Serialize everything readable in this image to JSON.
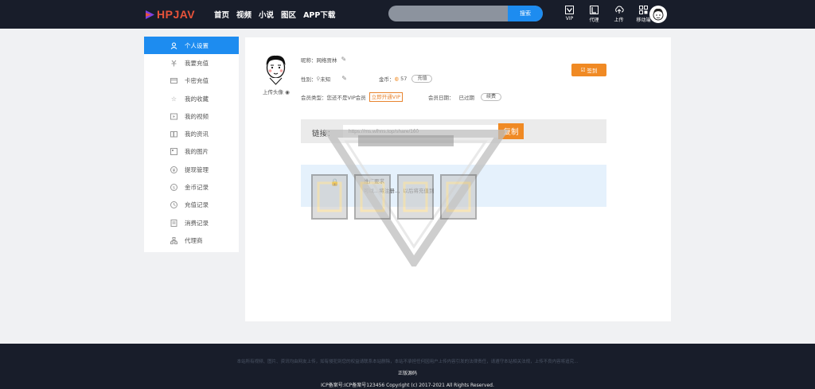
{
  "header": {
    "logo_text": "HPJAV",
    "nav": [
      "首页",
      "视频",
      "小说",
      "图区",
      "APP下载"
    ],
    "search": {
      "placeholder": "",
      "button_label": "搜索"
    },
    "icons": [
      {
        "label": "VIP",
        "icon": "vip-icon"
      },
      {
        "label": "代理",
        "icon": "agent-icon"
      },
      {
        "label": "上传",
        "icon": "upload-icon"
      },
      {
        "label": "移动端",
        "icon": "qrcode-icon"
      }
    ]
  },
  "sidebar": {
    "items": [
      {
        "label": "个人设置",
        "icon": "user-icon",
        "active": true
      },
      {
        "label": "我要充值",
        "icon": "recharge-icon"
      },
      {
        "label": "卡密充值",
        "icon": "card-icon"
      },
      {
        "label": "我的收藏",
        "icon": "star-icon"
      },
      {
        "label": "我的视频",
        "icon": "video-icon"
      },
      {
        "label": "我的资讯",
        "icon": "book-icon"
      },
      {
        "label": "我的图片",
        "icon": "image-icon"
      },
      {
        "label": "提现管理",
        "icon": "withdraw-icon"
      },
      {
        "label": "金币记录",
        "icon": "coin-icon"
      },
      {
        "label": "充值记录",
        "icon": "record-icon"
      },
      {
        "label": "消费记录",
        "icon": "consume-icon"
      },
      {
        "label": "代理商",
        "icon": "network-icon"
      }
    ]
  },
  "profile": {
    "upload_avatar": "上传头像",
    "nickname_label": "昵称：",
    "nickname": "网络贾林",
    "gender_label": "性别：",
    "gender": "未知",
    "coins_label": "金币：",
    "coins": "57",
    "recharge_btn": "充值",
    "member_type_label": "会员类型：",
    "member_type": "您还不是VIP会员",
    "open_vip_btn": "立即开通VIP",
    "member_date_label": "会员日期：",
    "member_date": "已过期",
    "renew_btn": "续费",
    "sign_btn": "签到"
  },
  "share": {
    "label": "链接：",
    "url": "https://ms.wlhns.top/share/160",
    "copy_btn": "复制"
  },
  "tips": {
    "title": "推广要求",
    "text": "可以...将注册..，以后将充值到"
  },
  "footer": {
    "disclaimer": "本站所有视频、图片、资讯均由网友上传，如有侵犯到您的权益请联系本站删除，本站不承担任何因用户上传内容引发的法律责任，请遵守本站相关法规，上传不良内容将追究...",
    "link": "正版源码",
    "copyright": "ICP备案号:ICP备案号123456    Copyright (c) 2017-2021 All Rights Reserved."
  },
  "colors": {
    "header_bg": "#181d2a",
    "accent_blue": "#1d8cf0",
    "accent_orange": "#f08a24"
  }
}
